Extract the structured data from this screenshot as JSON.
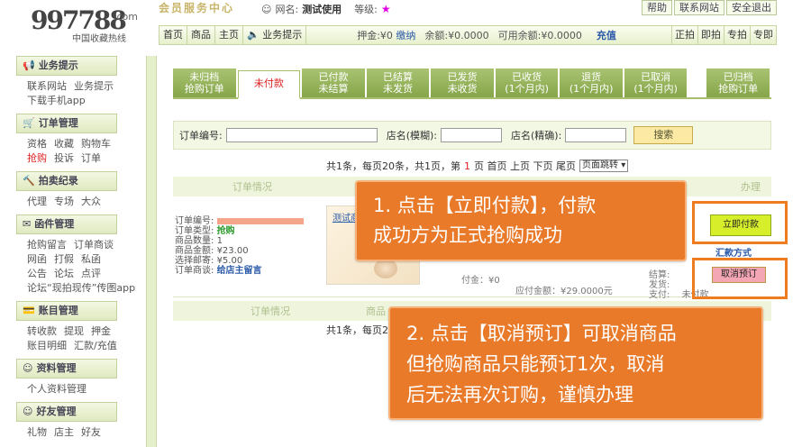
{
  "header": {
    "logo_number": "997788",
    "logo_com": ".com",
    "logo_tagline": "中国收藏热线",
    "banner_title": "会员服务中心",
    "username_label": "网名:",
    "username_value": "测试使用",
    "level_label": "等级:",
    "level_icon": "★",
    "top_links": [
      "帮助",
      "联系网站",
      "安全退出"
    ],
    "nav_items": [
      "首页",
      "商品",
      "主页",
      "业务提示"
    ],
    "deposit_label": "押金:",
    "deposit_value": "¥0",
    "deposit_link": "缴纳",
    "balance_label": "余额:",
    "balance_value": "¥0.0000",
    "available_label": "可用余额:",
    "available_value": "¥0.0000",
    "recharge_link": "充值",
    "nav_right": [
      "正拍",
      "即拍",
      "专拍",
      "专即"
    ]
  },
  "sidebar": {
    "sections": [
      {
        "title": "业务提示",
        "icon": "megaphone-icon",
        "rows": [
          [
            "联系网站",
            "业务提示"
          ],
          [
            "下载手机app"
          ]
        ]
      },
      {
        "title": "订单管理",
        "icon": "cart-icon",
        "rows": [
          [
            "资格",
            "收藏",
            "购物车"
          ],
          [
            "抢购",
            "投诉",
            "订单"
          ]
        ]
      },
      {
        "title": "拍卖纪录",
        "icon": "gavel-icon",
        "rows": [
          [
            "代理",
            "专场",
            "大众"
          ]
        ]
      },
      {
        "title": "函件管理",
        "icon": "mail-icon",
        "rows": [
          [
            "抢购留言",
            "订单商谈"
          ],
          [
            "网函",
            "打假",
            "私函"
          ],
          [
            "公告",
            "论坛",
            "点评"
          ],
          [
            "论坛“现拍现传”传图app"
          ]
        ]
      },
      {
        "title": "账目管理",
        "icon": "card-icon",
        "rows": [
          [
            "转收款",
            "提现",
            "押金"
          ],
          [
            "账目明细",
            "汇款/充值"
          ]
        ]
      },
      {
        "title": "资料管理",
        "icon": "user-icon",
        "rows": [
          [
            "个人资料管理"
          ]
        ]
      },
      {
        "title": "好友管理",
        "icon": "friends-icon",
        "rows": [
          [
            "礼物",
            "店主",
            "好友"
          ]
        ]
      }
    ]
  },
  "tabs": [
    {
      "label": "未归档\n抢购订单",
      "active": false
    },
    {
      "label": "未付款",
      "active": true
    },
    {
      "label": "已付款\n未结算",
      "active": false
    },
    {
      "label": "已结算\n未发货",
      "active": false
    },
    {
      "label": "已发货\n未收货",
      "active": false
    },
    {
      "label": "已收货\n(1个月内)",
      "active": false
    },
    {
      "label": "退货\n(1个月内)",
      "active": false
    },
    {
      "label": "已取消\n(1个月内)",
      "active": false
    },
    {
      "label": "已归档\n抢购订单",
      "active": false
    }
  ],
  "search": {
    "order_no_label": "订单编号:",
    "shop_fuzzy_label": "店名(模糊):",
    "shop_exact_label": "店名(精确):",
    "search_button": "搜索"
  },
  "pager": {
    "summary_a": "共1条，每页20条，共1页，第",
    "current_page": "1",
    "summary_b": "页 首页 上页 下页 尾页",
    "jump_select": "页面跳转",
    "bottom_text": "共1条，每页20"
  },
  "table": {
    "head_top": [
      "订单情况",
      "办理"
    ],
    "head_bottom": [
      "订单情况",
      "商品"
    ]
  },
  "order": {
    "order_no_label": "订单编号:",
    "type_label": "订单类型:",
    "type_value": "抢购",
    "qty_label": "商品数量:",
    "qty_value": "1",
    "amount_label": "商品金额:",
    "amount_value": "¥23.00",
    "shipping_label": "选择邮寄:",
    "shipping_value": "¥5.00",
    "chat_label": "订单商谈:",
    "chat_link": "给店主留言",
    "item_link": "测试商",
    "price_partial": "付金：¥0",
    "due_partial": "应付金额：¥29.0000元",
    "settle_label": "结算:",
    "ship_label": "发货:",
    "pay_label": "支付:",
    "pay_status": "未付款",
    "pay_button": "立即付款",
    "pay_method_link": "汇款方式",
    "cancel_button": "取消预订"
  },
  "callouts": {
    "step1": [
      "1. 点击【立即付款】，付款",
      "成功方为正式抢购成功"
    ],
    "step2": [
      "2. 点击【取消预订】可取消商品",
      "但抢购商品只能预订1次，取消",
      "后无法再次订购，谨慎办理"
    ]
  },
  "colors": {
    "tab_green": "#9bb860",
    "callout_orange": "#e87a2a",
    "pay_button": "#d7ef2b",
    "cancel_button": "#f4a6b4",
    "highlight": "#f07c20"
  }
}
